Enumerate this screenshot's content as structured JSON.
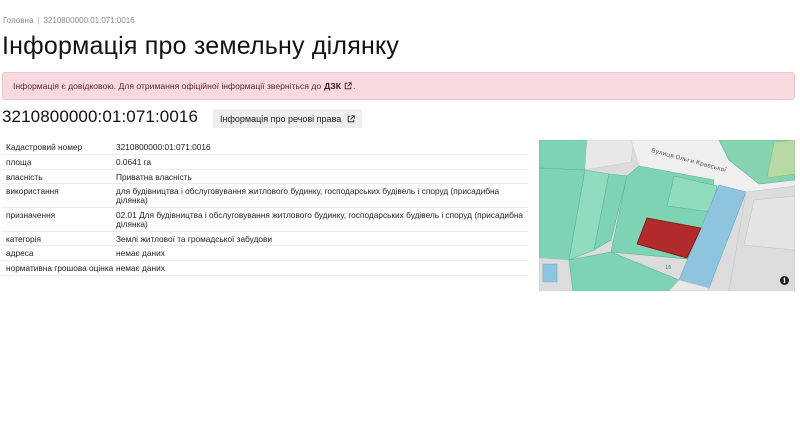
{
  "breadcrumb": {
    "home": "Головна",
    "separator": "|",
    "current": "3210800000:01:071:0016"
  },
  "page_title": "Інформація про земельну ділянку",
  "alert": {
    "text": "Інформація є довідковою. Для отримання офіційної інформації зверніться до",
    "link": "ДЗК",
    "suffix": "."
  },
  "cadastral_heading": "3210800000:01:071:0016",
  "rights_button_label": "Інформація про речові права",
  "table": [
    {
      "label": "Кадастровий номер",
      "value": "3210800000:01:071:0016"
    },
    {
      "label": "площа",
      "value": "0.0641 га"
    },
    {
      "label": "власність",
      "value": "Приватна власність"
    },
    {
      "label": "використання",
      "value": "для будівництва і обслуговування житлового будинку, господарських будівель і споруд (присадибна ділянка)"
    },
    {
      "label": "призначення",
      "value": "02.01 Для будівництва і обслуговування житлового будинку, господарських будівель і споруд (присадибна ділянка)"
    },
    {
      "label": "категорія",
      "value": "Землі житлової та громадської забудови"
    },
    {
      "label": "адреса",
      "value": "немає даних"
    },
    {
      "label": "нормативна грошова оцінка",
      "value": "немає даних"
    }
  ],
  "map": {
    "street_label": "Вулиця Ольги Кравської",
    "parcel_number": "16",
    "colors": {
      "parcel_selected": "#b22a2a",
      "parcel_green": "#7ed3b4",
      "parcel_blue": "#8fc4de",
      "background": "#dcdcdc"
    }
  },
  "icons": {
    "external_link": "external-link-icon",
    "info": "info-icon"
  }
}
